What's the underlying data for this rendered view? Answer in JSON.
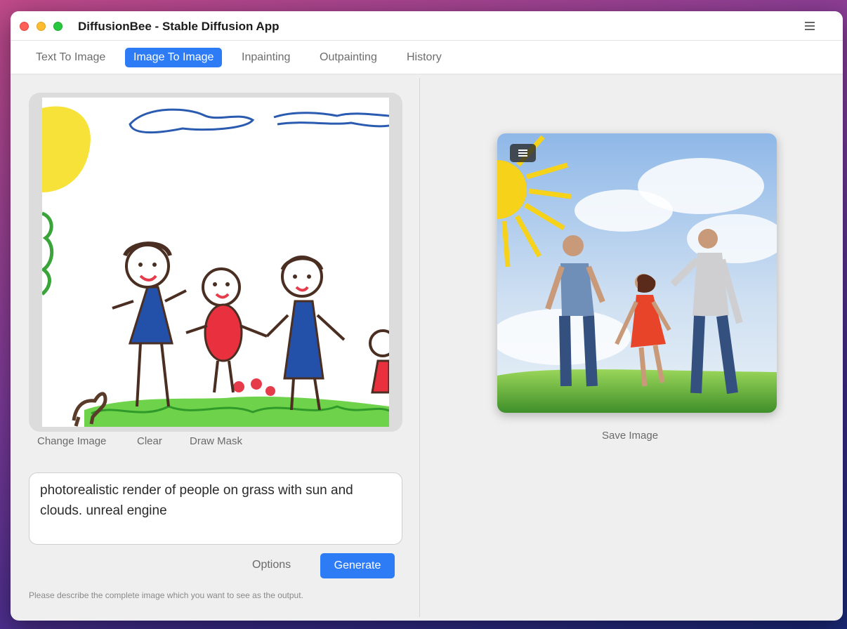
{
  "window": {
    "title": "DiffusionBee - Stable Diffusion App"
  },
  "tabs": [
    {
      "label": "Text To Image",
      "active": false
    },
    {
      "label": "Image To Image",
      "active": true
    },
    {
      "label": "Inpainting",
      "active": false
    },
    {
      "label": "Outpainting",
      "active": false
    },
    {
      "label": "History",
      "active": false
    }
  ],
  "input_image": {
    "actions": {
      "change": "Change Image",
      "clear": "Clear",
      "draw_mask": "Draw Mask"
    }
  },
  "prompt": {
    "value": "photorealistic render of people on grass with sun and clouds. unreal engine"
  },
  "buttons": {
    "options": "Options",
    "generate": "Generate"
  },
  "hint": "Please describe the complete image which you want to see as the output.",
  "output": {
    "save_label": "Save Image"
  },
  "icons": {
    "window_menu": "hamburger-menu-icon",
    "image_menu": "hamburger-menu-icon"
  },
  "colors": {
    "accent": "#2d7cf6",
    "close": "#fe5f57",
    "minimize": "#febc2e",
    "zoom": "#28c840"
  }
}
